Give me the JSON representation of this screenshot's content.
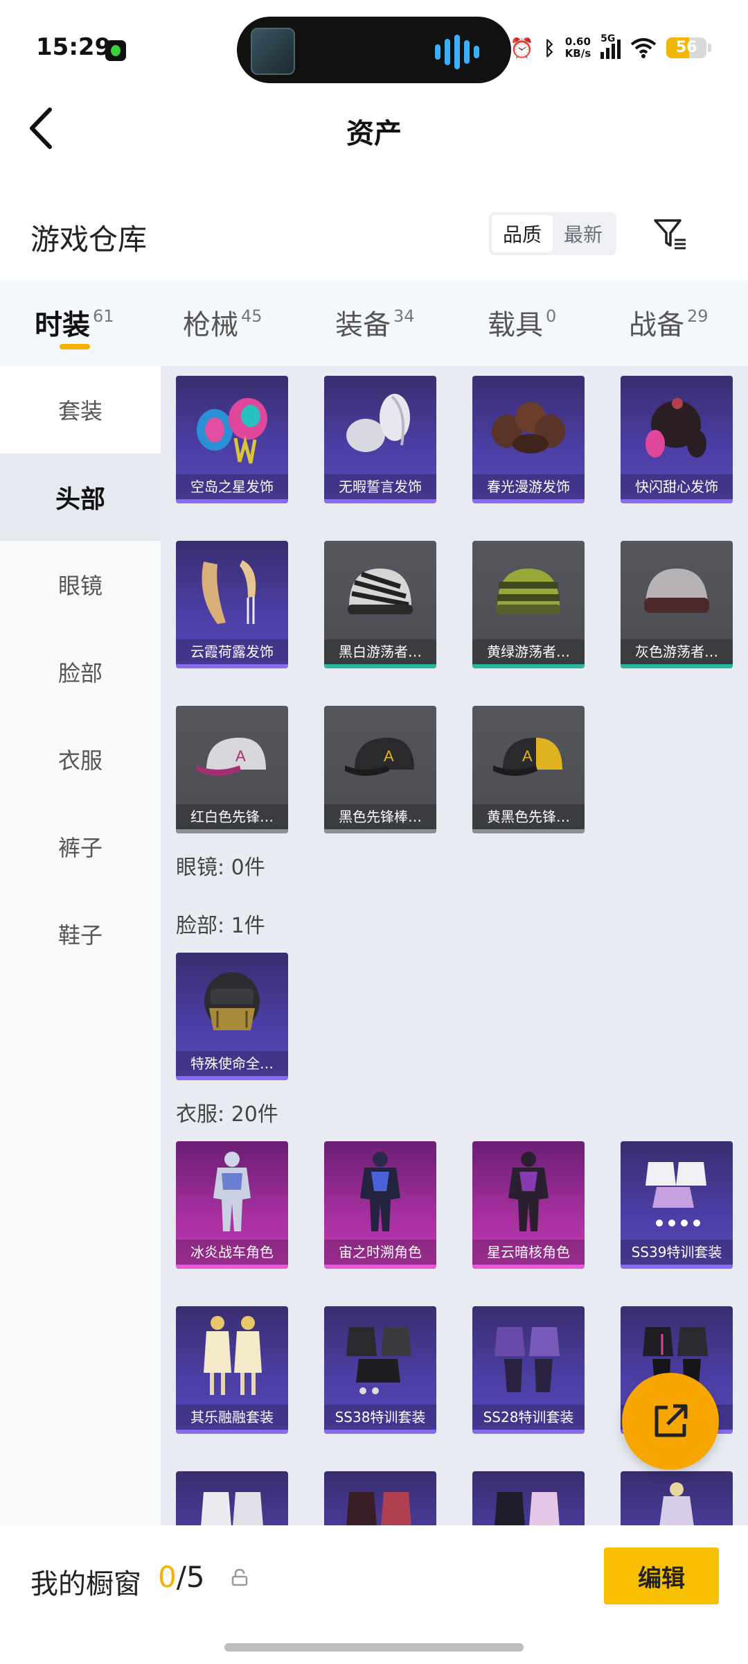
{
  "status_bar": {
    "time": "15:29",
    "net_speed_value": "0.60",
    "net_speed_unit": "KB/s",
    "network": "5G",
    "battery": "56"
  },
  "header": {
    "title": "资产"
  },
  "warehouse": {
    "title": "游戏仓库",
    "sort_options": [
      "品质",
      "最新"
    ],
    "active_sort": "品质"
  },
  "tabs": [
    {
      "label": "时装",
      "count": "61"
    },
    {
      "label": "枪械",
      "count": "45"
    },
    {
      "label": "装备",
      "count": "34"
    },
    {
      "label": "载具",
      "count": "0"
    },
    {
      "label": "战备",
      "count": "29"
    }
  ],
  "sidebar": {
    "items": [
      "套装",
      "头部",
      "眼镜",
      "脸部",
      "衣服",
      "裤子",
      "鞋子"
    ],
    "active": "头部"
  },
  "sections": {
    "head_items": [
      {
        "label": "空岛之星发饰",
        "style": "purple"
      },
      {
        "label": "无暇誓言发饰",
        "style": "purple"
      },
      {
        "label": "春光漫游发饰",
        "style": "purple"
      },
      {
        "label": "快闪甜心发饰",
        "style": "purple"
      },
      {
        "label": "云霞荷露发饰",
        "style": "purple"
      },
      {
        "label": "黑白游荡者…",
        "style": "gray-teal"
      },
      {
        "label": "黄绿游荡者…",
        "style": "gray-teal"
      },
      {
        "label": "灰色游荡者…",
        "style": "gray-teal"
      },
      {
        "label": "红白色先锋…",
        "style": "gray"
      },
      {
        "label": "黑色先锋棒…",
        "style": "gray"
      },
      {
        "label": "黄黑色先锋…",
        "style": "gray"
      }
    ],
    "glasses_header": "眼镜: 0件",
    "face_header": "脸部: 1件",
    "face_items": [
      {
        "label": "特殊使命全…",
        "style": "purple"
      }
    ],
    "clothes_header": "衣服: 20件",
    "clothes_items": [
      {
        "label": "冰炎战车角色",
        "style": "pink"
      },
      {
        "label": "宙之时溯角色",
        "style": "pink"
      },
      {
        "label": "星云暗核角色",
        "style": "pink"
      },
      {
        "label": "SS39特训套装",
        "style": "purple"
      },
      {
        "label": "其乐融融套装",
        "style": "purple"
      },
      {
        "label": "SS38特训套装",
        "style": "purple"
      },
      {
        "label": "SS28特训套装",
        "style": "purple"
      },
      {
        "label": "",
        "style": "purple"
      }
    ]
  },
  "bottom_bar": {
    "showcase_label": "我的橱窗",
    "showcase_current": "0",
    "showcase_total": "/5",
    "edit_label": "编辑"
  },
  "colors": {
    "accent": "#f5b000",
    "edit_button": "#f7bf00",
    "purple_card": "#4b3ea3",
    "pink_card": "#a7309f",
    "gray_card": "#4a4c52"
  }
}
